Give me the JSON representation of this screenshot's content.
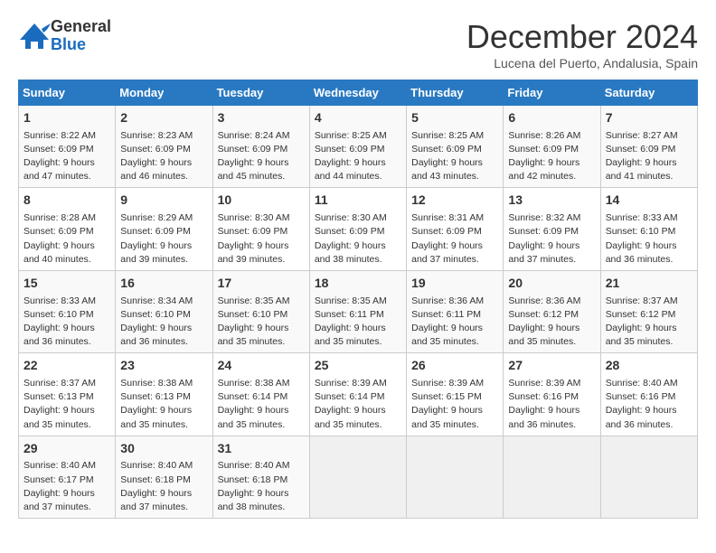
{
  "logo": {
    "general": "General",
    "blue": "Blue"
  },
  "title": "December 2024",
  "subtitle": "Lucena del Puerto, Andalusia, Spain",
  "days_header": [
    "Sunday",
    "Monday",
    "Tuesday",
    "Wednesday",
    "Thursday",
    "Friday",
    "Saturday"
  ],
  "weeks": [
    [
      {
        "day": "1",
        "sunrise": "Sunrise: 8:22 AM",
        "sunset": "Sunset: 6:09 PM",
        "daylight": "Daylight: 9 hours and 47 minutes."
      },
      {
        "day": "2",
        "sunrise": "Sunrise: 8:23 AM",
        "sunset": "Sunset: 6:09 PM",
        "daylight": "Daylight: 9 hours and 46 minutes."
      },
      {
        "day": "3",
        "sunrise": "Sunrise: 8:24 AM",
        "sunset": "Sunset: 6:09 PM",
        "daylight": "Daylight: 9 hours and 45 minutes."
      },
      {
        "day": "4",
        "sunrise": "Sunrise: 8:25 AM",
        "sunset": "Sunset: 6:09 PM",
        "daylight": "Daylight: 9 hours and 44 minutes."
      },
      {
        "day": "5",
        "sunrise": "Sunrise: 8:25 AM",
        "sunset": "Sunset: 6:09 PM",
        "daylight": "Daylight: 9 hours and 43 minutes."
      },
      {
        "day": "6",
        "sunrise": "Sunrise: 8:26 AM",
        "sunset": "Sunset: 6:09 PM",
        "daylight": "Daylight: 9 hours and 42 minutes."
      },
      {
        "day": "7",
        "sunrise": "Sunrise: 8:27 AM",
        "sunset": "Sunset: 6:09 PM",
        "daylight": "Daylight: 9 hours and 41 minutes."
      }
    ],
    [
      {
        "day": "8",
        "sunrise": "Sunrise: 8:28 AM",
        "sunset": "Sunset: 6:09 PM",
        "daylight": "Daylight: 9 hours and 40 minutes."
      },
      {
        "day": "9",
        "sunrise": "Sunrise: 8:29 AM",
        "sunset": "Sunset: 6:09 PM",
        "daylight": "Daylight: 9 hours and 39 minutes."
      },
      {
        "day": "10",
        "sunrise": "Sunrise: 8:30 AM",
        "sunset": "Sunset: 6:09 PM",
        "daylight": "Daylight: 9 hours and 39 minutes."
      },
      {
        "day": "11",
        "sunrise": "Sunrise: 8:30 AM",
        "sunset": "Sunset: 6:09 PM",
        "daylight": "Daylight: 9 hours and 38 minutes."
      },
      {
        "day": "12",
        "sunrise": "Sunrise: 8:31 AM",
        "sunset": "Sunset: 6:09 PM",
        "daylight": "Daylight: 9 hours and 37 minutes."
      },
      {
        "day": "13",
        "sunrise": "Sunrise: 8:32 AM",
        "sunset": "Sunset: 6:09 PM",
        "daylight": "Daylight: 9 hours and 37 minutes."
      },
      {
        "day": "14",
        "sunrise": "Sunrise: 8:33 AM",
        "sunset": "Sunset: 6:10 PM",
        "daylight": "Daylight: 9 hours and 36 minutes."
      }
    ],
    [
      {
        "day": "15",
        "sunrise": "Sunrise: 8:33 AM",
        "sunset": "Sunset: 6:10 PM",
        "daylight": "Daylight: 9 hours and 36 minutes."
      },
      {
        "day": "16",
        "sunrise": "Sunrise: 8:34 AM",
        "sunset": "Sunset: 6:10 PM",
        "daylight": "Daylight: 9 hours and 36 minutes."
      },
      {
        "day": "17",
        "sunrise": "Sunrise: 8:35 AM",
        "sunset": "Sunset: 6:10 PM",
        "daylight": "Daylight: 9 hours and 35 minutes."
      },
      {
        "day": "18",
        "sunrise": "Sunrise: 8:35 AM",
        "sunset": "Sunset: 6:11 PM",
        "daylight": "Daylight: 9 hours and 35 minutes."
      },
      {
        "day": "19",
        "sunrise": "Sunrise: 8:36 AM",
        "sunset": "Sunset: 6:11 PM",
        "daylight": "Daylight: 9 hours and 35 minutes."
      },
      {
        "day": "20",
        "sunrise": "Sunrise: 8:36 AM",
        "sunset": "Sunset: 6:12 PM",
        "daylight": "Daylight: 9 hours and 35 minutes."
      },
      {
        "day": "21",
        "sunrise": "Sunrise: 8:37 AM",
        "sunset": "Sunset: 6:12 PM",
        "daylight": "Daylight: 9 hours and 35 minutes."
      }
    ],
    [
      {
        "day": "22",
        "sunrise": "Sunrise: 8:37 AM",
        "sunset": "Sunset: 6:13 PM",
        "daylight": "Daylight: 9 hours and 35 minutes."
      },
      {
        "day": "23",
        "sunrise": "Sunrise: 8:38 AM",
        "sunset": "Sunset: 6:13 PM",
        "daylight": "Daylight: 9 hours and 35 minutes."
      },
      {
        "day": "24",
        "sunrise": "Sunrise: 8:38 AM",
        "sunset": "Sunset: 6:14 PM",
        "daylight": "Daylight: 9 hours and 35 minutes."
      },
      {
        "day": "25",
        "sunrise": "Sunrise: 8:39 AM",
        "sunset": "Sunset: 6:14 PM",
        "daylight": "Daylight: 9 hours and 35 minutes."
      },
      {
        "day": "26",
        "sunrise": "Sunrise: 8:39 AM",
        "sunset": "Sunset: 6:15 PM",
        "daylight": "Daylight: 9 hours and 35 minutes."
      },
      {
        "day": "27",
        "sunrise": "Sunrise: 8:39 AM",
        "sunset": "Sunset: 6:16 PM",
        "daylight": "Daylight: 9 hours and 36 minutes."
      },
      {
        "day": "28",
        "sunrise": "Sunrise: 8:40 AM",
        "sunset": "Sunset: 6:16 PM",
        "daylight": "Daylight: 9 hours and 36 minutes."
      }
    ],
    [
      {
        "day": "29",
        "sunrise": "Sunrise: 8:40 AM",
        "sunset": "Sunset: 6:17 PM",
        "daylight": "Daylight: 9 hours and 37 minutes."
      },
      {
        "day": "30",
        "sunrise": "Sunrise: 8:40 AM",
        "sunset": "Sunset: 6:18 PM",
        "daylight": "Daylight: 9 hours and 37 minutes."
      },
      {
        "day": "31",
        "sunrise": "Sunrise: 8:40 AM",
        "sunset": "Sunset: 6:18 PM",
        "daylight": "Daylight: 9 hours and 38 minutes."
      },
      null,
      null,
      null,
      null
    ]
  ]
}
